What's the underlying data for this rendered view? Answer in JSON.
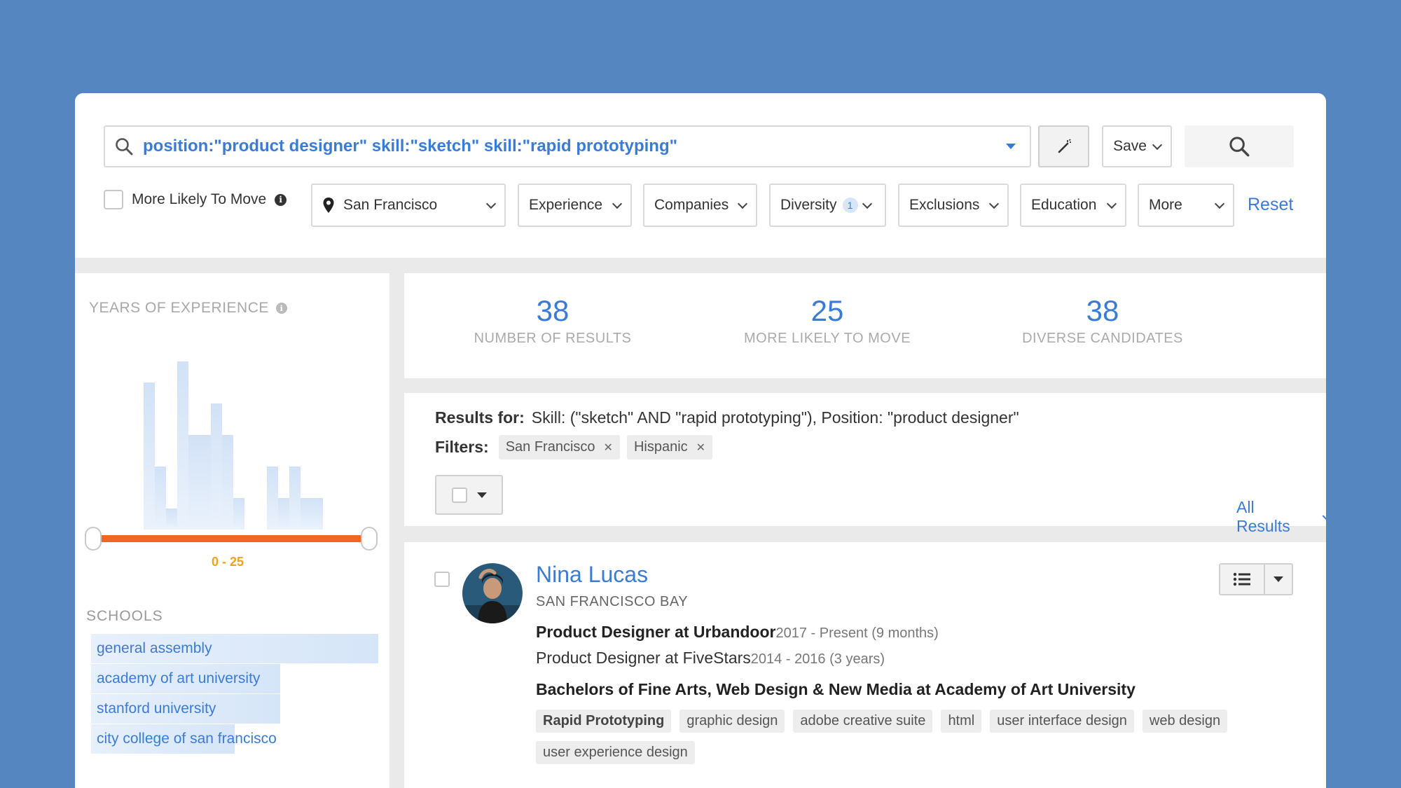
{
  "search": {
    "query": "position:\"product designer\" skill:\"sketch\" skill:\"rapid prototyping\"",
    "save_label": "Save"
  },
  "filters": {
    "more_likely_label": "More Likely To Move",
    "location": "San Francisco",
    "experience": "Experience",
    "companies": "Companies",
    "diversity": "Diversity",
    "diversity_count": "1",
    "exclusions": "Exclusions",
    "education": "Education",
    "more": "More",
    "reset": "Reset"
  },
  "sidebar": {
    "yoe_title": "YEARS OF EXPERIENCE",
    "yoe_range": "0 - 25",
    "histogram": [
      0,
      0,
      70,
      30,
      10,
      80,
      45,
      45,
      60,
      45,
      15,
      0,
      0,
      30,
      15,
      30,
      15,
      15
    ],
    "schools_title": "SCHOOLS",
    "schools": [
      {
        "name": "general assembly",
        "share": 1.0
      },
      {
        "name": "academy of art university",
        "share": 0.66
      },
      {
        "name": "stanford university",
        "share": 0.66
      },
      {
        "name": "city college of san francisco",
        "share": 0.5
      }
    ]
  },
  "stats": [
    {
      "value": "38",
      "label": "NUMBER OF RESULTS"
    },
    {
      "value": "25",
      "label": "MORE LIKELY TO MOVE"
    },
    {
      "value": "38",
      "label": "DIVERSE CANDIDATES"
    }
  ],
  "results": {
    "results_for_label": "Results for:",
    "results_for_text": "Skill: (\"sketch\" AND \"rapid prototyping\"), Position: \"product designer\"",
    "filters_label": "Filters:",
    "chips": [
      "San Francisco",
      "Hispanic"
    ],
    "all_results": "All Results"
  },
  "candidate": {
    "name": "Nina Lucas",
    "location": "SAN FRANCISCO BAY",
    "position1": "Product Designer at Urbandoor",
    "position1_dates": "2017 - Present (9 months)",
    "position2": "Product Designer at FiveStars",
    "position2_dates": "2014 - 2016 (3 years)",
    "education": "Bachelors of Fine Arts, Web Design & New Media at Academy of Art University",
    "tags": [
      "Rapid Prototyping",
      "graphic design",
      "adobe creative suite",
      "html",
      "user interface design",
      "web design",
      "user experience design"
    ]
  },
  "colors": {
    "background": "#5586c0",
    "accent": "#3a7bd5",
    "slider": "#f26622",
    "range_label": "#f2a11f"
  }
}
